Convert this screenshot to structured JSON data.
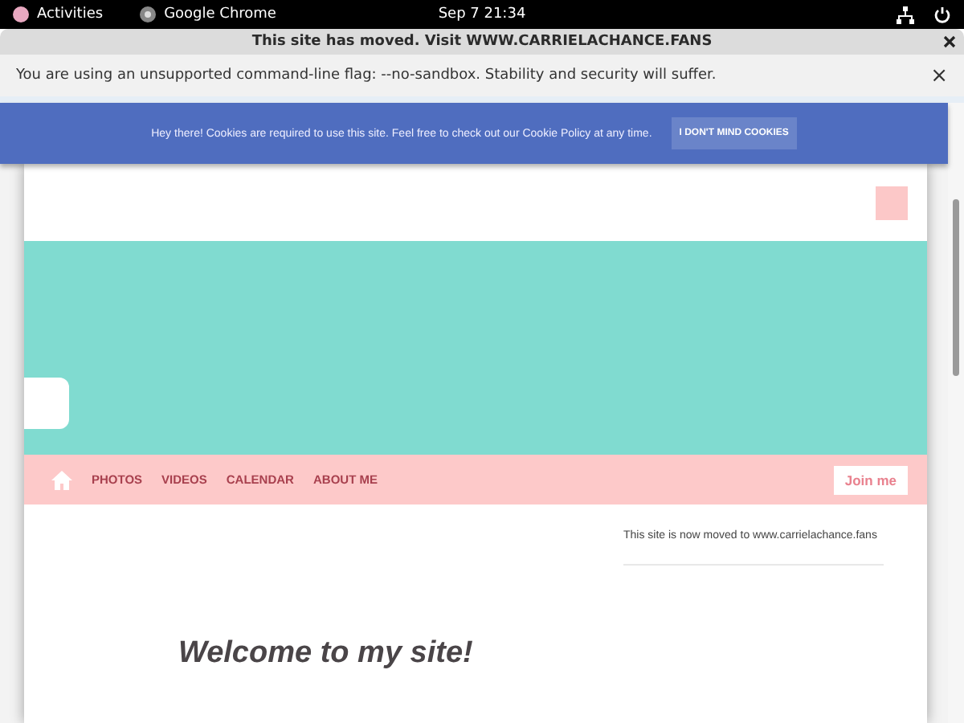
{
  "top_bar": {
    "activities": "Activities",
    "app": "Google Chrome",
    "clock": "Sep 7  21:34"
  },
  "window": {
    "title": "This site has moved. Visit WWW.CARRIELACHANCE.FANS"
  },
  "info_bar": {
    "message": "You are using an unsupported command-line flag: --no-sandbox. Stability and security will suffer.",
    "close": "×"
  },
  "cookie_banner": {
    "message": "Hey there! Cookies are required to use this site. Feel free to check out our Cookie Policy at any time.",
    "button": "I DON'T MIND COOKIES"
  },
  "nav": {
    "items": [
      "PHOTOS",
      "VIDEOS",
      "CALENDAR",
      "ABOUT ME"
    ],
    "join": "Join me"
  },
  "sidebar": {
    "notice": "This site is now moved to www.carrielachance.fans"
  },
  "main": {
    "heading": "Welcome to my site!"
  }
}
